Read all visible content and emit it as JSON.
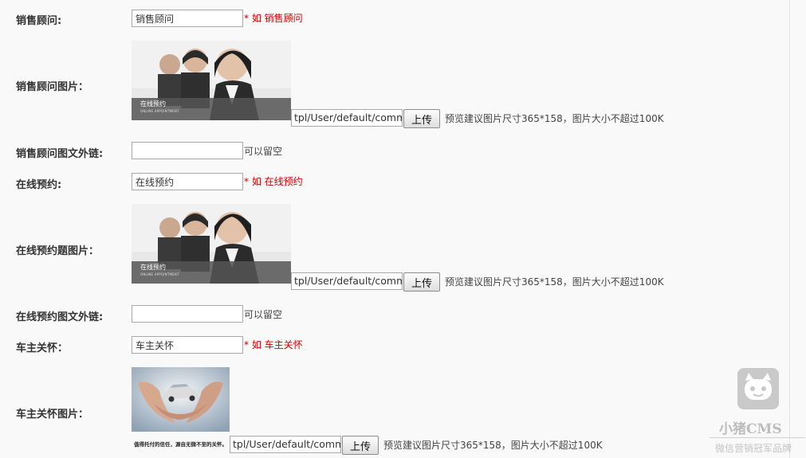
{
  "rows": {
    "sales_advisor": {
      "label": "销售顾问:",
      "value": "销售顾问",
      "hint": "* 如 销售顾问"
    },
    "sales_advisor_image": {
      "label": "销售顾问图片：",
      "overlay_text": "在线预约",
      "overlay_sub": "ONLINE APPOINTMENT",
      "path": "tpl/User/default/common/images/",
      "upload": "上传",
      "note": "预览建议图片尺寸365*158，图片大小不超过100K"
    },
    "sales_advisor_link": {
      "label": "销售顾问图文外链:",
      "value": "",
      "hint": "可以留空"
    },
    "online_booking": {
      "label": "在线预约:",
      "value": "在线预约",
      "hint": "* 如 在线预约"
    },
    "online_booking_image": {
      "label": "在线预约题图片：",
      "overlay_text": "在线预约",
      "overlay_sub": "ONLINE APPOINTMENT",
      "path": "tpl/User/default/common/images/",
      "upload": "上传",
      "note": "预览建议图片尺寸365*158，图片大小不超过100K"
    },
    "online_booking_link": {
      "label": "在线预约图文外链:",
      "value": "",
      "hint": "可以留空"
    },
    "owner_care": {
      "label": "车主关怀：",
      "value": "车主关怀",
      "hint": "* 如 车主关怀"
    },
    "owner_care_image": {
      "label": "车主关怀图片：",
      "caption": "值得托付的信任，源自无微不至的关怀。",
      "path": "tpl/User/default/common/images/",
      "upload": "上传",
      "note": "预览建议图片尺寸365*158，图片大小不超过100K"
    }
  },
  "watermark": {
    "name": "小猪CMS",
    "slogan": "微信营销冠军品牌"
  }
}
